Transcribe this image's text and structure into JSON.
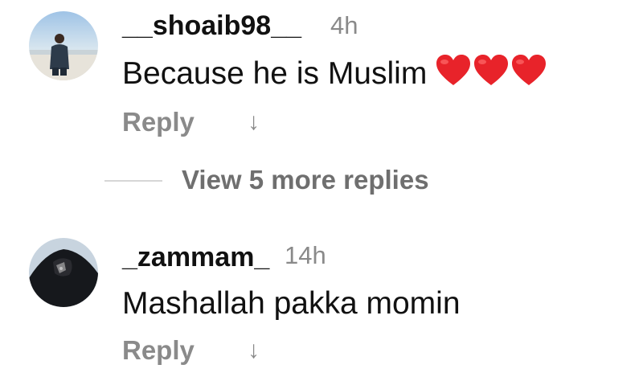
{
  "comments": [
    {
      "username": "__shoaib98__",
      "time": "4h",
      "text": "Because he is Muslim",
      "emoji": "❤️❤️❤️",
      "reply_label": "Reply",
      "avatar_icon": "user-avatar-photo"
    },
    {
      "username": "_zammam_",
      "time": "14h",
      "text": "Mashallah pakka momin",
      "reply_label": "Reply",
      "avatar_icon": "user-avatar-photo"
    }
  ],
  "view_more_label": "View 5 more replies",
  "icons": {
    "expand_arrow": "arrow-down-icon",
    "heart": "red-heart-icon"
  },
  "colors": {
    "username": "#111111",
    "secondary": "#8a8a8a",
    "heart": "#e8232a"
  }
}
